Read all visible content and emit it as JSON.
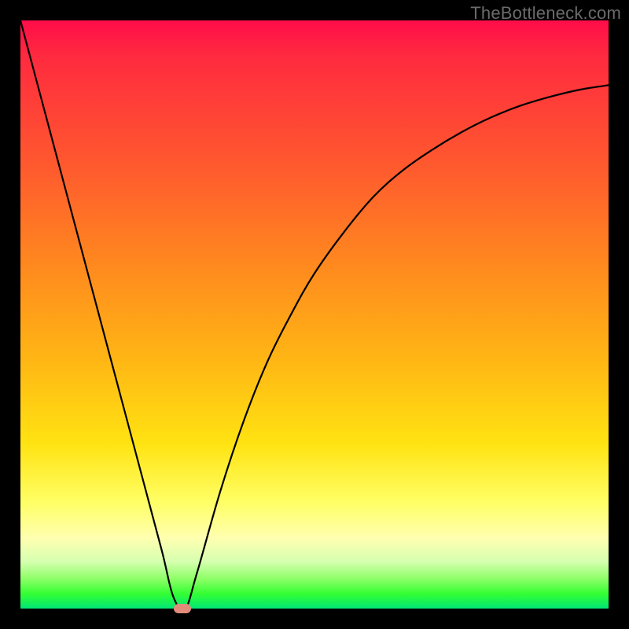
{
  "watermark": "TheBottleneck.com",
  "chart_data": {
    "type": "line",
    "title": "",
    "xlabel": "",
    "ylabel": "",
    "xlim": [
      0,
      100
    ],
    "ylim": [
      0,
      100
    ],
    "grid": false,
    "legend": false,
    "series": [
      {
        "name": "bottleneck-curve",
        "x": [
          0,
          4,
          8,
          12,
          16,
          20,
          24,
          26,
          28,
          30,
          34,
          38,
          42,
          46,
          50,
          55,
          60,
          65,
          70,
          75,
          80,
          85,
          90,
          95,
          100
        ],
        "y": [
          100,
          85,
          70,
          55,
          40,
          25,
          10,
          2,
          0,
          6,
          20,
          32,
          42,
          50,
          57,
          64,
          70,
          74.5,
          78,
          81,
          83.5,
          85.5,
          87,
          88.2,
          89
        ]
      }
    ],
    "minimum_marker": {
      "x": 27.5,
      "y": 0
    },
    "gradient_stops": [
      {
        "pos": 0,
        "color": "#ff0d4a"
      },
      {
        "pos": 25,
        "color": "#ff5a2e"
      },
      {
        "pos": 58,
        "color": "#ffb714"
      },
      {
        "pos": 82,
        "color": "#ffff66"
      },
      {
        "pos": 95,
        "color": "#8cff66"
      },
      {
        "pos": 100,
        "color": "#00e676"
      }
    ]
  }
}
